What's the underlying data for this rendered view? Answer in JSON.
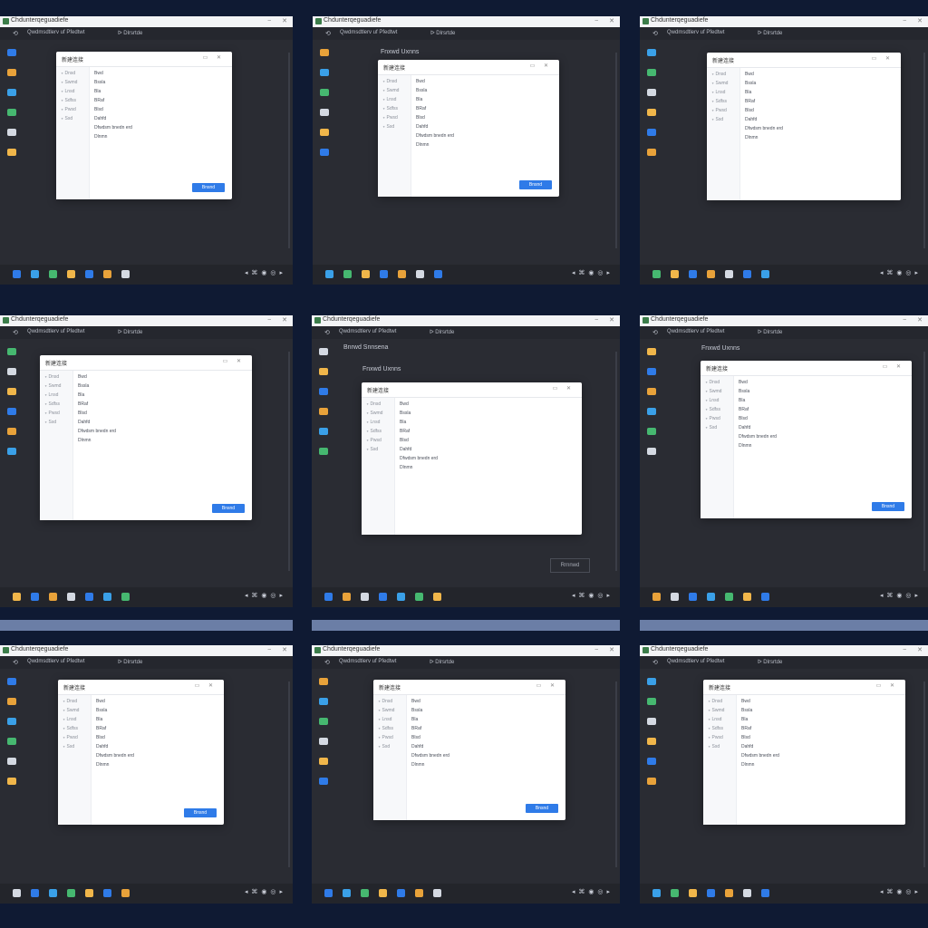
{
  "titlebar": {
    "title": "Chdunterqeguadiefe",
    "minimize": "⎯",
    "close": "✕"
  },
  "toolbar": {
    "back": "⟲",
    "path": "Qwdmsdtlerv uf Pfedtwt",
    "tab": "ᐅ Dlrsrtde"
  },
  "background_labels": {
    "a": "Fnxwd Uxnns",
    "b": "Bnrwd Snnsena",
    "c": "Rrnnwd"
  },
  "dialog": {
    "title": "新建连接",
    "controls": "▭ ✕",
    "left_items": [
      "∘ Dnsd",
      "∘ Swmd",
      "∘ Lnsd",
      "∘ Sdfss",
      "∘ Pwsd",
      "∘ Ssd"
    ],
    "right_items": [
      "Bwd",
      "Bssla",
      "Bla",
      "BRaf",
      "Blsd",
      "Dahfd",
      "Dfwdsm bnedn erd",
      "Dlnmn"
    ],
    "ok_label": "Bnsnd"
  },
  "taskbar": {
    "tray": "◂ ⌘ ◉ ◎ ▸"
  },
  "colors": {
    "page_bg": "#0f1a33",
    "window_bg": "#2a2c33",
    "accent": "#2f7be8",
    "dialog_bg": "#ffffff"
  },
  "icons": [
    "back-icon",
    "app-icon",
    "minimize-icon",
    "close-icon",
    "side-icons",
    "taskbar-icons",
    "tray-icons"
  ]
}
